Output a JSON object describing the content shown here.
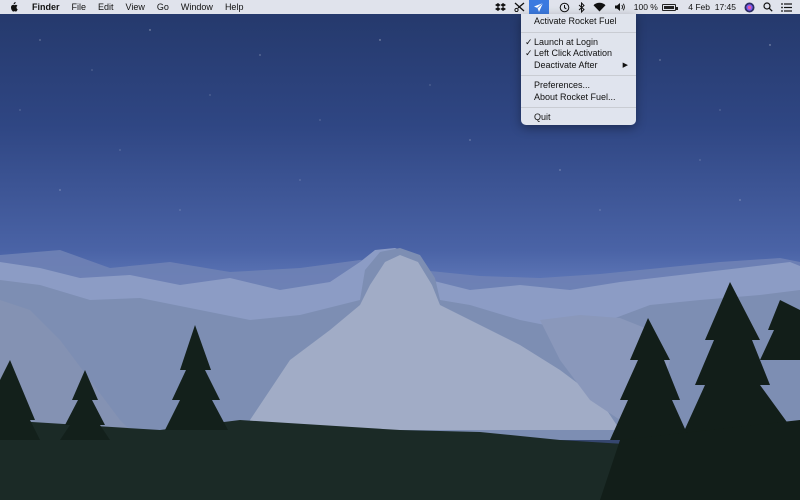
{
  "menubar": {
    "apple_icon": "apple-logo-icon",
    "app_name": "Finder",
    "menus": [
      "File",
      "Edit",
      "View",
      "Go",
      "Window",
      "Help"
    ],
    "battery_percent": "100 %",
    "battery_level": 1.0,
    "date": "4 Feb",
    "time": "17:45",
    "tray_icons": [
      "dropbox-icon",
      "rocket-fuel-icon",
      "time-machine-icon",
      "bluetooth-icon",
      "wifi-icon",
      "volume-icon",
      "siri-icon",
      "search-icon",
      "notification-center-icon"
    ]
  },
  "dropdown": {
    "items": [
      {
        "label": "Activate Rocket Fuel",
        "checked": false
      },
      {
        "label": "Launch at Login",
        "checked": true
      },
      {
        "label": "Left Click Activation",
        "checked": true
      },
      {
        "label": "Deactivate After",
        "checked": false,
        "submenu": true
      },
      {
        "label": "Preferences...",
        "checked": false
      },
      {
        "label": "About Rocket Fuel...",
        "checked": false
      },
      {
        "label": "Quit",
        "checked": false
      }
    ],
    "check_glyph": "✓",
    "submenu_glyph": "▶"
  },
  "colors": {
    "highlight": "#3b7ae0",
    "menubar_bg": "#eceef4",
    "sky_top": "#24386a"
  }
}
